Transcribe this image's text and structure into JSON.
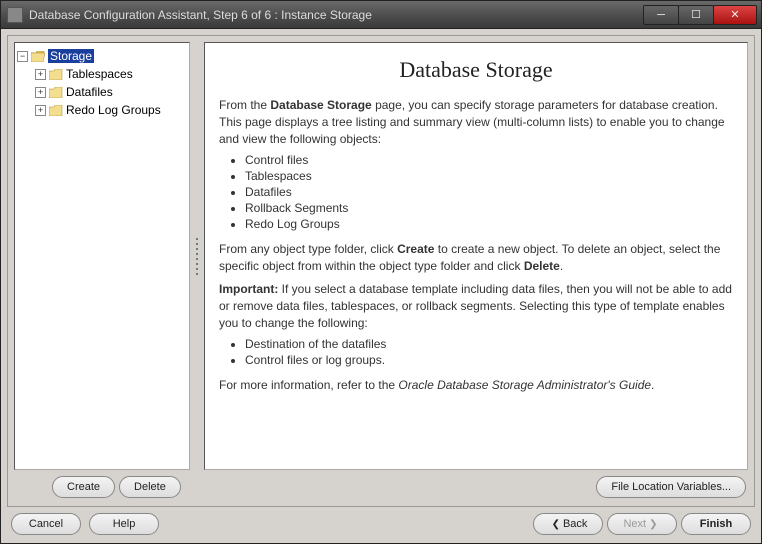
{
  "window": {
    "title": "Database Configuration Assistant, Step 6 of 6 : Instance Storage"
  },
  "tree": {
    "root": {
      "label": "Storage",
      "selected": true
    },
    "children": [
      {
        "label": "Tablespaces"
      },
      {
        "label": "Datafiles"
      },
      {
        "label": "Redo Log Groups"
      }
    ]
  },
  "page": {
    "heading": "Database Storage",
    "intro_pre": "From the ",
    "intro_bold": "Database Storage",
    "intro_post": " page, you can specify storage parameters for database creation. This page displays a tree listing and summary view (multi-column lists) to enable you to change and view the following objects:",
    "object_list": [
      "Control files",
      "Tablespaces",
      "Datafiles",
      "Rollback Segments",
      "Redo Log Groups"
    ],
    "create_delete_pre": "From any object type folder, click ",
    "create_word": "Create",
    "create_delete_mid": " to create a new object. To delete an object, select the specific object from within the object type folder and click ",
    "delete_word": "Delete",
    "create_delete_post": ".",
    "important_label": "Important:",
    "important_text": " If you select a database template including data files, then you will not be able to add or remove data files, tablespaces, or rollback segments. Selecting this type of template enables you to change the following:",
    "template_list": [
      "Destination of the datafiles",
      "Control files or log groups."
    ],
    "moreinfo_pre": "For more information, refer to the ",
    "moreinfo_doc": "Oracle Database Storage Administrator's Guide",
    "moreinfo_post": "."
  },
  "buttons": {
    "create": "Create",
    "delete": "Delete",
    "file_loc": "File Location Variables...",
    "cancel": "Cancel",
    "help": "Help",
    "back": "Back",
    "next": "Next",
    "finish": "Finish"
  }
}
